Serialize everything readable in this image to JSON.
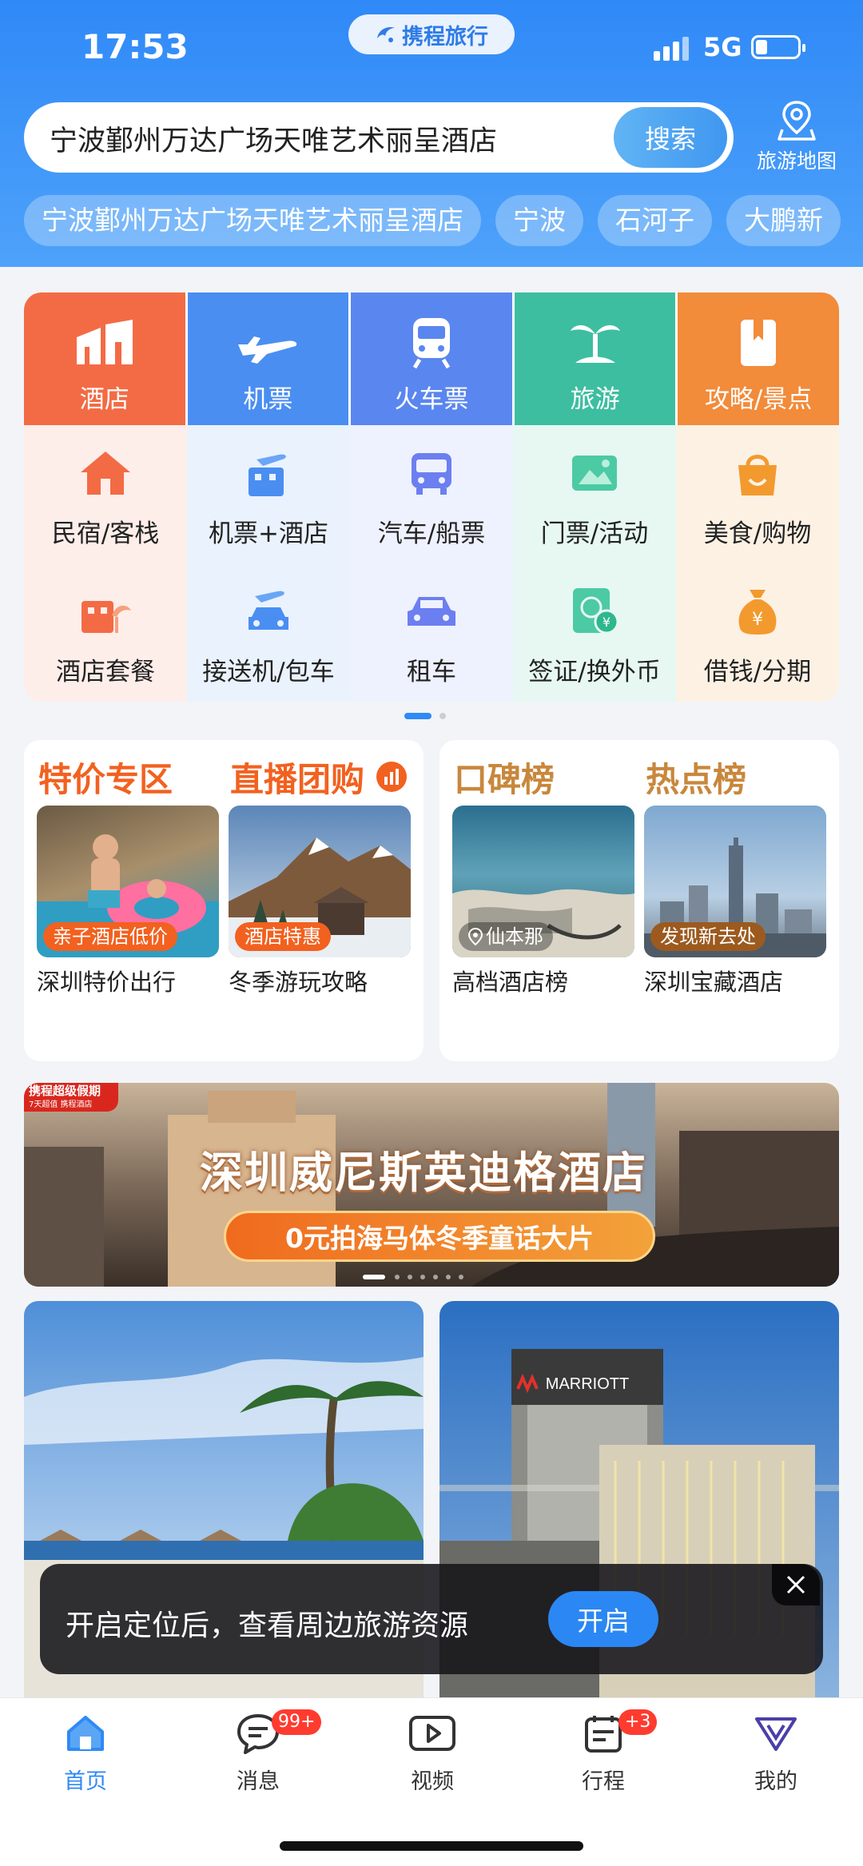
{
  "status_bar": {
    "time": "17:53",
    "network": "5G"
  },
  "app": {
    "brand": "携程旅行"
  },
  "search": {
    "value": "宁波鄞州万达广场天唯艺术丽呈酒店",
    "button": "搜索",
    "map_button": "旅游地图"
  },
  "history_chips": [
    "宁波鄞州万达广场天唯艺术丽呈酒店",
    "宁波",
    "石河子",
    "大鹏新"
  ],
  "main_services": [
    {
      "label": "酒店",
      "icon": "hotel-icon",
      "color": "#f36b45"
    },
    {
      "label": "机票",
      "icon": "plane-icon",
      "color": "#4a8ef2"
    },
    {
      "label": "火车票",
      "icon": "train-icon",
      "color": "#5a86f0"
    },
    {
      "label": "旅游",
      "icon": "palm-tree-icon",
      "color": "#3dbea0"
    },
    {
      "label": "攻略/景点",
      "icon": "guide-book-icon",
      "color": "#f28b3a"
    }
  ],
  "sub_services_row1": [
    {
      "label": "民宿/客栈",
      "icon": "house-icon"
    },
    {
      "label": "机票+酒店",
      "icon": "flight-hotel-icon"
    },
    {
      "label": "汽车/船票",
      "icon": "bus-icon"
    },
    {
      "label": "门票/活动",
      "icon": "ticket-icon"
    },
    {
      "label": "美食/购物",
      "icon": "shopping-bag-icon"
    }
  ],
  "sub_services_row2": [
    {
      "label": "酒店套餐",
      "icon": "hotel-package-icon"
    },
    {
      "label": "接送机/包车",
      "icon": "car-transfer-icon"
    },
    {
      "label": "租车",
      "icon": "rental-car-icon"
    },
    {
      "label": "签证/换外币",
      "icon": "visa-icon"
    },
    {
      "label": "借钱/分期",
      "icon": "money-bag-icon"
    }
  ],
  "promo_left": {
    "title1": "特价专区",
    "title2": "直播团购",
    "items": [
      {
        "tag": "亲子酒店低价",
        "caption": "深圳特价出行"
      },
      {
        "tag": "酒店特惠",
        "caption": "冬季游玩攻略"
      }
    ]
  },
  "promo_right": {
    "title1": "口碑榜",
    "title2": "热点榜",
    "items": [
      {
        "tag": "仙本那",
        "caption": "高档酒店榜"
      },
      {
        "tag": "发现新去处",
        "caption": "深圳宝藏酒店"
      }
    ]
  },
  "banner": {
    "corner_logo": "携程超级假期",
    "corner_sub": "7天超值 携程酒店",
    "title": "深圳威尼斯英迪格酒店",
    "subtitle": "0元拍海马体冬季童话大片"
  },
  "photo_right": {
    "sign": "MARRIOTT"
  },
  "toast": {
    "text": "开启定位后，查看周边旅游资源",
    "button": "开启"
  },
  "tab_bar": [
    {
      "label": "首页",
      "icon": "home-icon",
      "active": true
    },
    {
      "label": "消息",
      "icon": "message-icon",
      "badge": "99+"
    },
    {
      "label": "视频",
      "icon": "video-icon"
    },
    {
      "label": "行程",
      "icon": "itinerary-icon",
      "badge": "+3"
    },
    {
      "label": "我的",
      "icon": "profile-icon"
    }
  ],
  "colors": {
    "accent": "#2f89f7",
    "promo_orange": "#f2611f",
    "ranking_gold": "#c8873c",
    "badge_red": "#ff3b30"
  }
}
